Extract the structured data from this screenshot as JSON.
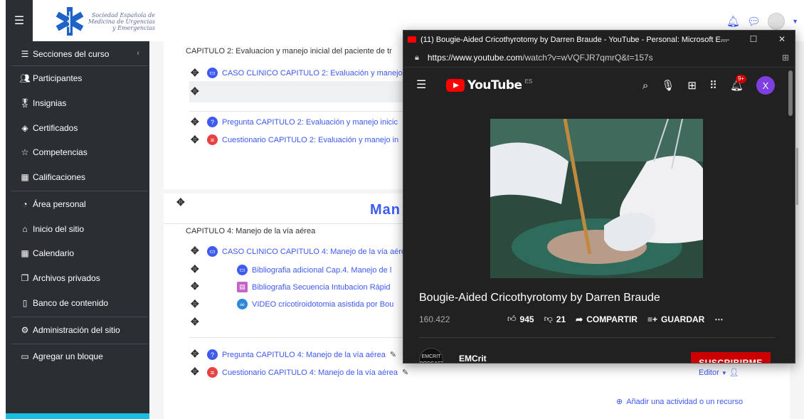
{
  "top": {
    "logo_text": [
      "Sociedad Española de",
      "Medicina de Urgencias",
      "y Emergencias"
    ]
  },
  "sidebar": {
    "items": [
      {
        "label": "Secciones del curso",
        "icon": "list-icon"
      },
      {
        "label": "Participantes",
        "icon": "users-icon"
      },
      {
        "label": "Insignias",
        "icon": "badge-icon"
      },
      {
        "label": "Certificados",
        "icon": "certificate-icon"
      },
      {
        "label": "Competencias",
        "icon": "star-icon"
      },
      {
        "label": "Calificaciones",
        "icon": "table-icon"
      },
      {
        "label": "Área personal",
        "icon": "dashboard-icon"
      },
      {
        "label": "Inicio del sitio",
        "icon": "home-icon"
      },
      {
        "label": "Calendario",
        "icon": "calendar-icon"
      },
      {
        "label": "Archivos privados",
        "icon": "files-icon"
      },
      {
        "label": "Banco de contenido",
        "icon": "clipboard-icon"
      },
      {
        "label": "Administración del sitio",
        "icon": "gear-icon"
      },
      {
        "label": "Agregar un bloque",
        "icon": "folder-icon"
      }
    ]
  },
  "main": {
    "chapter2_caption": "CAPITULO 2: Evaluacion y manejo inicial del paciente de tr",
    "chapter2_items": [
      "CASO CLINICO CAPITULO 2: Evaluación y manejo",
      "Pregunta CAPITULO 2: Evaluación y manejo inicic",
      "Cuestionario CAPITULO 2: Evaluación y manejo in"
    ],
    "section_heading": "Man",
    "chapter4_caption": "CAPITULO 4: Manejo de la vía aérea",
    "chapter4_items": [
      "CASO CLINICO CAPITULO 4: Manejo de la vía aére",
      "Bibliografia adicional Cap.4. Manejo de l",
      "Bibliografia Secuencia Intubacion Rápid",
      "VIDEO cricotiroidotomia asistida por Bou"
    ],
    "chapter4_bottom_items": [
      "Pregunta CAPITULO 4: Manejo de la vía aérea",
      "Cuestionario CAPITULO 4: Manejo de la vía aérea"
    ],
    "editor_label": "Editor",
    "add_activity": "Añadir una actividad o un recurso"
  },
  "popup": {
    "window_title": "(11) Bougie-Aided Cricothyrotomy by Darren Braude - YouTube - Personal: Microsoft E...",
    "url_host": "https://www.youtube.com",
    "url_rest": "/watch?v=wVQFJR7qmrQ&t=157s",
    "yt_wordmark": "YouTube",
    "yt_region": "ES",
    "notif_badge": "9+",
    "avatar_letter": "X",
    "video_title": "Bougie-Aided Cricothyrotomy by Darren Braude",
    "views": "160.422",
    "likes": "945",
    "dislikes": "21",
    "share": "COMPARTIR",
    "save": "GUARDAR",
    "channel": "EMCrit",
    "channel_avatar_text": "EMCRIT PODCAST",
    "subscribe": "SUSCRIBIRME"
  },
  "colors": {
    "sidebar_bg": "#2a2f34",
    "link_blue": "#3d5af1",
    "yt_red": "#ff0000",
    "yt_bg": "#212121"
  }
}
